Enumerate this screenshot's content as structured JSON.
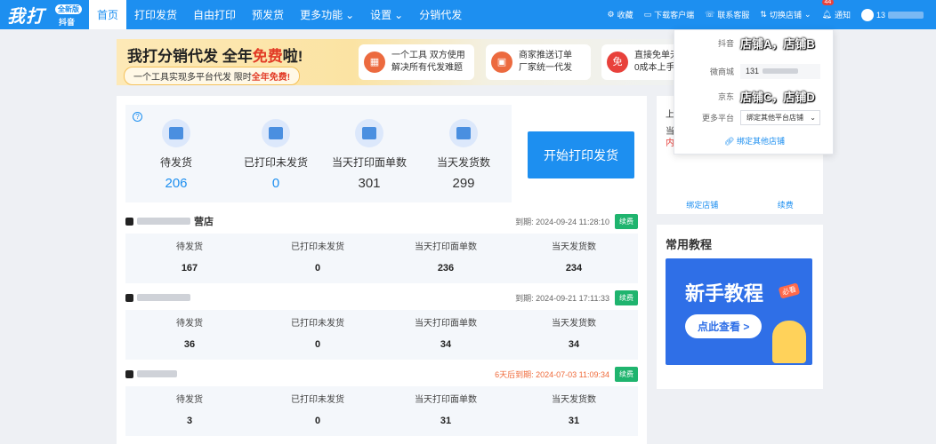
{
  "logo": {
    "text": "我打",
    "badge": "全新版",
    "sub": "抖音"
  },
  "nav": {
    "items": [
      {
        "label": "首页",
        "active": true
      },
      {
        "label": "打印发货"
      },
      {
        "label": "自由打印"
      },
      {
        "label": "预发货"
      },
      {
        "label": "更多功能",
        "caret": true
      },
      {
        "label": "设置",
        "caret": true
      },
      {
        "label": "分销代发"
      }
    ],
    "right": {
      "favorite": "收藏",
      "download": "下载客户端",
      "service": "联系客服",
      "switch_shop": "切换店铺",
      "notice": "通知",
      "notice_count": "44",
      "user": "13"
    }
  },
  "banner": {
    "title_a": "我打分销代发 全年",
    "title_b": "免费",
    "title_c": "啦!",
    "sub_a": "一个工具实现多平台代发 限时",
    "sub_b": "全年免费!",
    "cards": [
      {
        "line1": "一个工具 双方使用",
        "line2": "解决所有代发难题"
      },
      {
        "line1": "商家推送订单",
        "line2": "厂家统一代发"
      },
      {
        "line1": "直接免单无",
        "line2": "0成本上手"
      }
    ]
  },
  "stats": {
    "items": [
      {
        "label": "待发货",
        "value": "206"
      },
      {
        "label": "已打印未发货",
        "value": "0"
      },
      {
        "label": "当天打印面单数",
        "value": "301"
      },
      {
        "label": "当天发货数",
        "value": "299"
      }
    ],
    "print_button": "开始打印发货"
  },
  "shops": [
    {
      "name_suffix": "营店",
      "expire_label": "到期:",
      "expire": "2024-09-24 11:28:10",
      "renew": "续费",
      "labels": [
        "待发货",
        "已打印未发货",
        "当天打印面单数",
        "当天发货数"
      ],
      "values": [
        "167",
        "0",
        "236",
        "234"
      ]
    },
    {
      "name_suffix": "",
      "expire_label": "到期:",
      "expire": "2024-09-21 17:11:33",
      "renew": "续费",
      "labels": [
        "待发货",
        "已打印未发货",
        "当天打印面单数",
        "当天发货数"
      ],
      "values": [
        "36",
        "0",
        "34",
        "34"
      ]
    },
    {
      "name_suffix": "",
      "expire_warn": "6天后到期:",
      "expire": "2024-07-03 11:09:34",
      "renew": "续费",
      "labels": [
        "待发货",
        "已打印未发货",
        "当天打印面单数",
        "当天发货数"
      ],
      "values": [
        "3",
        "0",
        "31",
        "31"
      ]
    }
  ],
  "side": {
    "frag1": "上",
    "frag2": "当",
    "frag3": "内",
    "links": [
      "绑定店铺",
      "续费"
    ]
  },
  "tutorial": {
    "heading": "常用教程",
    "img_title": "新手教程",
    "img_tag": "必看",
    "img_button": "点此查看 >"
  },
  "dropdown": {
    "rows": [
      {
        "label": "抖音",
        "value": "店铺A，店铺B"
      },
      {
        "label": "微商城",
        "input": "131"
      },
      {
        "label": "京东",
        "value": "店铺C，店铺D"
      },
      {
        "label": "更多平台",
        "select": "绑定其他平台店铺"
      }
    ],
    "link": "绑定其他店铺"
  }
}
